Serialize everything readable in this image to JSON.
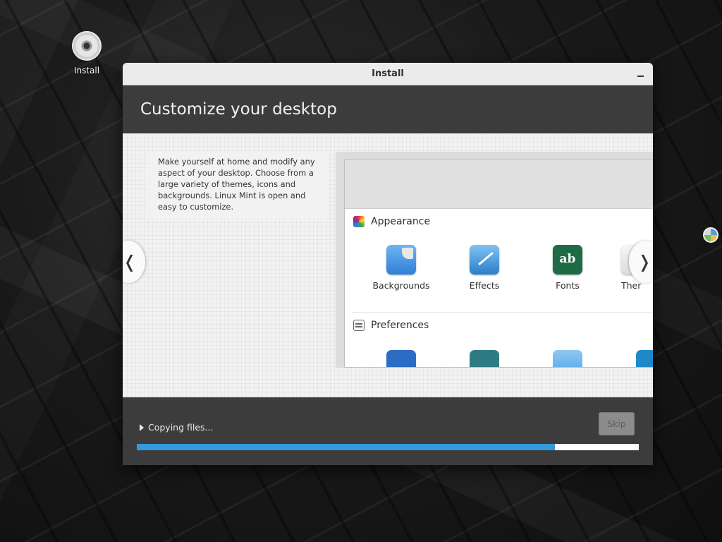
{
  "desktop": {
    "icons": [
      {
        "label": "Install",
        "icon": "cd-disc-icon"
      }
    ]
  },
  "window": {
    "title": "Install",
    "minimize_label": "–"
  },
  "slide": {
    "heading": "Customize your desktop",
    "description": "Make yourself at home and modify any aspect of your desktop. Choose from a large variety of themes, icons and backgrounds. Linux Mint is open and easy to customize.",
    "prev_label": "❬",
    "next_label": "❭",
    "screenshot": {
      "sections": [
        {
          "title": "Appearance",
          "icon": "appearance-icon",
          "apps": [
            {
              "label": "Backgrounds",
              "icon": "backgrounds-icon"
            },
            {
              "label": "Effects",
              "icon": "effects-icon"
            },
            {
              "label": "Fonts",
              "icon": "fonts-icon",
              "glyph": "ᵃb c"
            },
            {
              "label": "Ther",
              "icon": "themes-icon"
            }
          ]
        },
        {
          "title": "Preferences",
          "icon": "preferences-icon"
        }
      ]
    }
  },
  "footer": {
    "status": "Copying files...",
    "skip_label": "Skip",
    "progress_fraction": 0.833
  },
  "colors": {
    "progress": "#3498db",
    "window_bg": "#3c3c3c"
  }
}
